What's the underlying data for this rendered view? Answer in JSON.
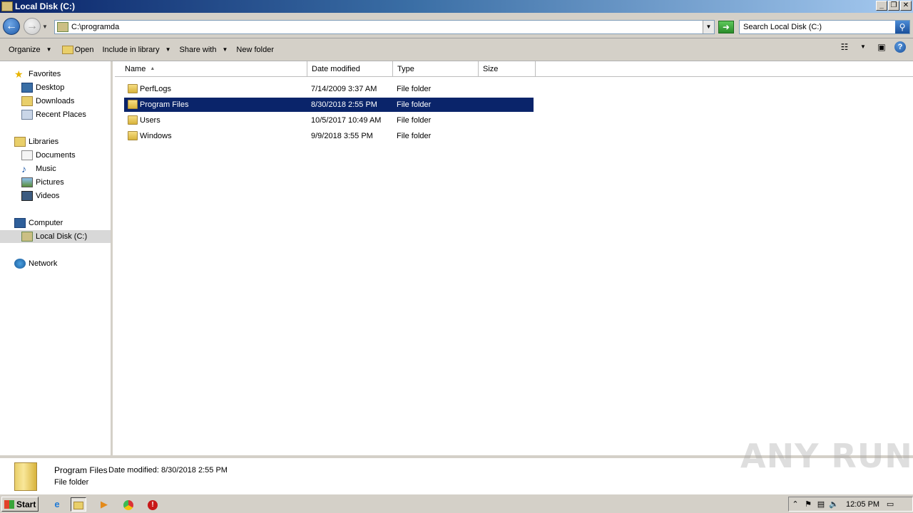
{
  "window": {
    "title": "Local Disk (C:)",
    "minimize": "_",
    "restore": "❐",
    "close": "✕"
  },
  "address": {
    "value": "C:\\programda",
    "search_placeholder": "Search Local Disk (C:)"
  },
  "toolbar": {
    "organize": "Organize",
    "open": "Open",
    "include_in_library": "Include in library",
    "share_with": "Share with",
    "new_folder": "New folder"
  },
  "nav": {
    "favorites": "Favorites",
    "desktop": "Desktop",
    "downloads": "Downloads",
    "recent_places": "Recent Places",
    "libraries": "Libraries",
    "documents": "Documents",
    "music": "Music",
    "pictures": "Pictures",
    "videos": "Videos",
    "computer": "Computer",
    "local_disk": "Local Disk (C:)",
    "network": "Network"
  },
  "columns": {
    "name": "Name",
    "date_modified": "Date modified",
    "type": "Type",
    "size": "Size"
  },
  "files": [
    {
      "name": "PerfLogs",
      "date": "7/14/2009 3:37 AM",
      "type": "File folder",
      "size": ""
    },
    {
      "name": "Program Files",
      "date": "8/30/2018 2:55 PM",
      "type": "File folder",
      "size": ""
    },
    {
      "name": "Users",
      "date": "10/5/2017 10:49 AM",
      "type": "File folder",
      "size": ""
    },
    {
      "name": "Windows",
      "date": "9/9/2018 3:55 PM",
      "type": "File folder",
      "size": ""
    }
  ],
  "selected_index": 1,
  "details": {
    "name": "Program Files",
    "date_label": "Date modified: 8/30/2018 2:55 PM",
    "type": "File folder"
  },
  "watermark": "ANY RUN",
  "taskbar": {
    "start": "Start",
    "clock": "12:05 PM"
  },
  "colors": {
    "selection": "#0a246a",
    "chrome": "#d4d0c8"
  }
}
